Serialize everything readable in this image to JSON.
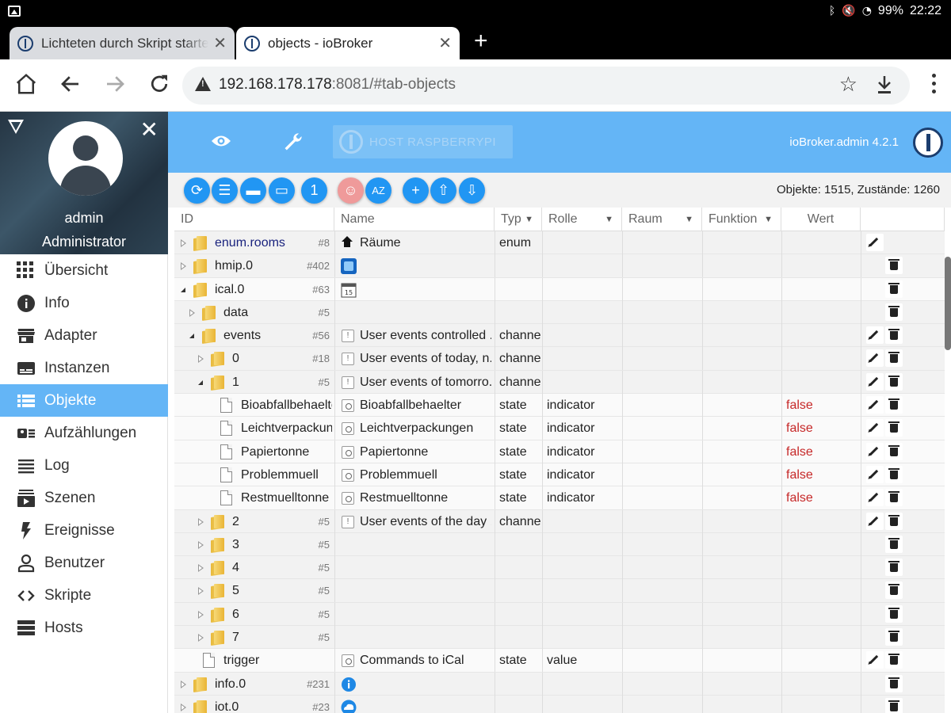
{
  "status": {
    "time": "22:22",
    "battery": "99%",
    "icons": [
      "bluetooth-icon",
      "mute-icon",
      "wifi-icon"
    ]
  },
  "tabs": [
    {
      "title": "Lichteten durch Skript starten",
      "active": false
    },
    {
      "title": "objects - ioBroker",
      "active": true
    }
  ],
  "address": {
    "host": "192.168.178.178",
    "rest": ":8081/#tab-objects"
  },
  "sidebar": {
    "user": "admin",
    "role": "Administrator",
    "items": [
      {
        "label": "Übersicht",
        "icon": "grid-icon"
      },
      {
        "label": "Info",
        "icon": "info-icon"
      },
      {
        "label": "Adapter",
        "icon": "store-icon"
      },
      {
        "label": "Instanzen",
        "icon": "instances-icon"
      },
      {
        "label": "Objekte",
        "icon": "list-icon",
        "active": true
      },
      {
        "label": "Aufzählungen",
        "icon": "enum-icon"
      },
      {
        "label": "Log",
        "icon": "log-icon"
      },
      {
        "label": "Szenen",
        "icon": "scenes-icon"
      },
      {
        "label": "Ereignisse",
        "icon": "flash-icon"
      },
      {
        "label": "Benutzer",
        "icon": "user-icon"
      },
      {
        "label": "Skripte",
        "icon": "code-icon"
      },
      {
        "label": "Hosts",
        "icon": "hosts-icon"
      }
    ]
  },
  "appbar": {
    "host": "HOST RASPBERRYPI",
    "version": "ioBroker.admin 4.2.1"
  },
  "toolbar": {
    "counts": "Objekte: 1515, Zustände: 1260",
    "buttons": [
      {
        "name": "refresh-button",
        "glyph": "⟳"
      },
      {
        "name": "list-view-button",
        "glyph": "☰"
      },
      {
        "name": "collapse-all-button",
        "glyph": "▬"
      },
      {
        "name": "expand-all-button",
        "glyph": "▭"
      },
      {
        "name": "level-button",
        "glyph": "1"
      },
      {
        "name": "expert-mode-button",
        "glyph": "☺"
      },
      {
        "name": "sort-az-button",
        "glyph": "AZ"
      },
      {
        "name": "add-object-button",
        "glyph": "+"
      },
      {
        "name": "upload-button",
        "glyph": "⇧"
      },
      {
        "name": "download-button",
        "glyph": "⇩"
      }
    ]
  },
  "columns": [
    "ID",
    "Name",
    "Typ",
    "Rolle",
    "Raum",
    "Funktion",
    "Wert"
  ],
  "rows": [
    {
      "indent": 0,
      "toggle": "closed",
      "icon": "folder",
      "id": "enum.rooms",
      "count": "#8",
      "nicon": "home",
      "name": "Räume",
      "typ": "enum",
      "rolle": "",
      "wert": "",
      "edit": true,
      "del": false,
      "idColor": "#1a237e"
    },
    {
      "indent": 0,
      "toggle": "closed",
      "icon": "folder",
      "id": "hmip.0",
      "count": "#402",
      "nicon": "hmip",
      "name": "",
      "typ": "",
      "rolle": "",
      "wert": "",
      "edit": false,
      "del": true
    },
    {
      "indent": 0,
      "toggle": "open",
      "icon": "folder",
      "id": "ical.0",
      "count": "#63",
      "nicon": "calendar",
      "name": "",
      "typ": "",
      "rolle": "",
      "wert": "",
      "edit": false,
      "del": true,
      "white": true
    },
    {
      "indent": 1,
      "toggle": "closed",
      "icon": "folder",
      "id": "data",
      "count": "#5",
      "nicon": "",
      "name": "",
      "typ": "",
      "rolle": "",
      "wert": "",
      "edit": false,
      "del": true
    },
    {
      "indent": 1,
      "toggle": "open",
      "icon": "folder",
      "id": "events",
      "count": "#56",
      "nicon": "channel",
      "name": "User events controlled ...",
      "typ": "channel",
      "rolle": "",
      "wert": "",
      "edit": true,
      "del": true
    },
    {
      "indent": 2,
      "toggle": "closed",
      "icon": "folder",
      "id": "0",
      "count": "#18",
      "nicon": "channel",
      "name": "User events of today, n...",
      "typ": "channel",
      "rolle": "",
      "wert": "",
      "edit": true,
      "del": true
    },
    {
      "indent": 2,
      "toggle": "open",
      "icon": "folder",
      "id": "1",
      "count": "#5",
      "nicon": "channel",
      "name": "User events of tomorro...",
      "typ": "channel",
      "rolle": "",
      "wert": "",
      "edit": true,
      "del": true
    },
    {
      "indent": 3,
      "toggle": "",
      "icon": "file",
      "id": "Bioabfallbehaelter",
      "count": "",
      "nicon": "state",
      "name": "Bioabfallbehaelter",
      "typ": "state",
      "rolle": "indicator",
      "wert": "false",
      "edit": true,
      "del": true,
      "white": true
    },
    {
      "indent": 3,
      "toggle": "",
      "icon": "file",
      "id": "Leichtverpackungen",
      "count": "",
      "nicon": "state",
      "name": "Leichtverpackungen",
      "typ": "state",
      "rolle": "indicator",
      "wert": "false",
      "edit": true,
      "del": true,
      "white": true
    },
    {
      "indent": 3,
      "toggle": "",
      "icon": "file",
      "id": "Papiertonne",
      "count": "",
      "nicon": "state",
      "name": "Papiertonne",
      "typ": "state",
      "rolle": "indicator",
      "wert": "false",
      "edit": true,
      "del": true,
      "white": true
    },
    {
      "indent": 3,
      "toggle": "",
      "icon": "file",
      "id": "Problemmuell",
      "count": "",
      "nicon": "state",
      "name": "Problemmuell",
      "typ": "state",
      "rolle": "indicator",
      "wert": "false",
      "edit": true,
      "del": true,
      "white": true
    },
    {
      "indent": 3,
      "toggle": "",
      "icon": "file",
      "id": "Restmuelltonne",
      "count": "",
      "nicon": "state",
      "name": "Restmuelltonne",
      "typ": "state",
      "rolle": "indicator",
      "wert": "false",
      "edit": true,
      "del": true,
      "white": true
    },
    {
      "indent": 2,
      "toggle": "closed",
      "icon": "folder",
      "id": "2",
      "count": "#5",
      "nicon": "channel",
      "name": "User events of the day ...",
      "typ": "channel",
      "rolle": "",
      "wert": "",
      "edit": true,
      "del": true
    },
    {
      "indent": 2,
      "toggle": "closed",
      "icon": "folder",
      "id": "3",
      "count": "#5",
      "nicon": "",
      "name": "",
      "typ": "",
      "rolle": "",
      "wert": "",
      "edit": false,
      "del": true
    },
    {
      "indent": 2,
      "toggle": "closed",
      "icon": "folder",
      "id": "4",
      "count": "#5",
      "nicon": "",
      "name": "",
      "typ": "",
      "rolle": "",
      "wert": "",
      "edit": false,
      "del": true
    },
    {
      "indent": 2,
      "toggle": "closed",
      "icon": "folder",
      "id": "5",
      "count": "#5",
      "nicon": "",
      "name": "",
      "typ": "",
      "rolle": "",
      "wert": "",
      "edit": false,
      "del": true
    },
    {
      "indent": 2,
      "toggle": "closed",
      "icon": "folder",
      "id": "6",
      "count": "#5",
      "nicon": "",
      "name": "",
      "typ": "",
      "rolle": "",
      "wert": "",
      "edit": false,
      "del": true
    },
    {
      "indent": 2,
      "toggle": "closed",
      "icon": "folder",
      "id": "7",
      "count": "#5",
      "nicon": "",
      "name": "",
      "typ": "",
      "rolle": "",
      "wert": "",
      "edit": false,
      "del": true
    },
    {
      "indent": 1,
      "toggle": "",
      "icon": "file",
      "id": "trigger",
      "count": "",
      "nicon": "state",
      "name": "Commands to iCal",
      "typ": "state",
      "rolle": "value",
      "wert": "",
      "edit": true,
      "del": true,
      "white": true
    },
    {
      "indent": 0,
      "toggle": "closed",
      "icon": "folder",
      "id": "info.0",
      "count": "#231",
      "nicon": "info",
      "name": "",
      "typ": "",
      "rolle": "",
      "wert": "",
      "edit": false,
      "del": true
    },
    {
      "indent": 0,
      "toggle": "closed",
      "icon": "folder",
      "id": "iot.0",
      "count": "#23",
      "nicon": "cloud",
      "name": "",
      "typ": "",
      "rolle": "",
      "wert": "",
      "edit": false,
      "del": true
    }
  ]
}
